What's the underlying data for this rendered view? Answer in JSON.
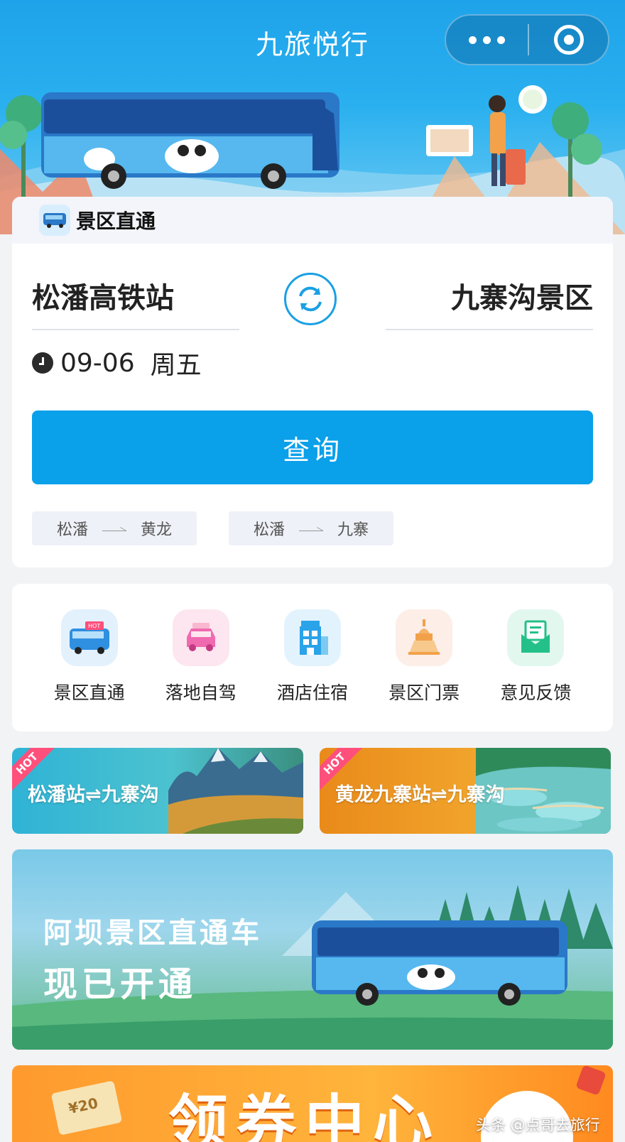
{
  "app": {
    "title": "九旅悦行"
  },
  "capsule": {
    "more_icon": "more-dots-icon",
    "close_icon": "target-circle-icon"
  },
  "search": {
    "tab_title": "景区直通",
    "from_station": "松潘高铁站",
    "to_station": "九寨沟景区",
    "date": "09-06",
    "weekday": "周五",
    "query_label": "查询",
    "quick_routes": [
      {
        "from": "松潘",
        "to": "黄龙"
      },
      {
        "from": "松潘",
        "to": "九寨"
      }
    ]
  },
  "services": [
    {
      "label": "景区直通",
      "icon": "bus-hot-icon",
      "color": "#2f8fe0"
    },
    {
      "label": "落地自驾",
      "icon": "car-icon",
      "color": "#f06ab0"
    },
    {
      "label": "酒店住宿",
      "icon": "hotel-icon",
      "color": "#2aa3e8"
    },
    {
      "label": "景区门票",
      "icon": "temple-icon",
      "color": "#f2a14a"
    },
    {
      "label": "意见反馈",
      "icon": "feedback-mail-icon",
      "color": "#24c08a"
    }
  ],
  "promos": [
    {
      "badge": "HOT",
      "text": "松潘站⇌九寨沟"
    },
    {
      "badge": "HOT",
      "text": "黄龙九寨站⇌九寨沟"
    }
  ],
  "big_banner": {
    "line1": "阿坝景区直通车",
    "line2": "现已开通"
  },
  "coupon": {
    "title": "领券中心",
    "ticket_value": "¥20"
  },
  "watermark": "头条 @点哥去旅行",
  "colors": {
    "primary": "#0aa0ea",
    "header_blue": "#1ea3ea",
    "hot_pink": "#ff4f7b"
  }
}
